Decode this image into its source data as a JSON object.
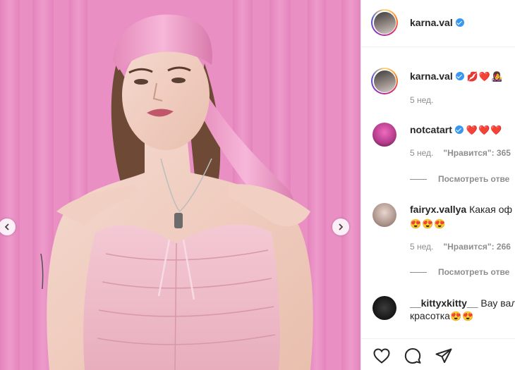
{
  "post": {
    "author": "karna.val",
    "verified": true,
    "caption": {
      "author": "karna.val",
      "emojis": "💋❤️👩‍🎤",
      "time": "5 нед."
    }
  },
  "comments": [
    {
      "user": "notcatart",
      "verified": true,
      "text": "",
      "emojis": "❤️❤️❤️",
      "time": "5 нед.",
      "likes": "\"Нравится\": 365",
      "replies": "Посмотреть отве"
    },
    {
      "user": "fairyx.vallya",
      "verified": false,
      "text": "Какая оф",
      "emojis": "😍😍😍",
      "time": "5 нед.",
      "likes": "\"Нравится\": 266",
      "replies": "Посмотреть отве"
    },
    {
      "user": "__kittyxkitty__",
      "verified": false,
      "text": "Вау вал",
      "text2": "красотка",
      "emojis": "😍😍"
    }
  ],
  "icons": {
    "prev": "chevron-left-icon",
    "next": "chevron-right-icon",
    "like": "heart-icon",
    "comment": "comment-icon",
    "share": "paper-plane-icon"
  },
  "colors": {
    "background_pink": "#e98fc4",
    "verified_blue": "#3897f0",
    "muted_text": "#8e8e8e"
  }
}
